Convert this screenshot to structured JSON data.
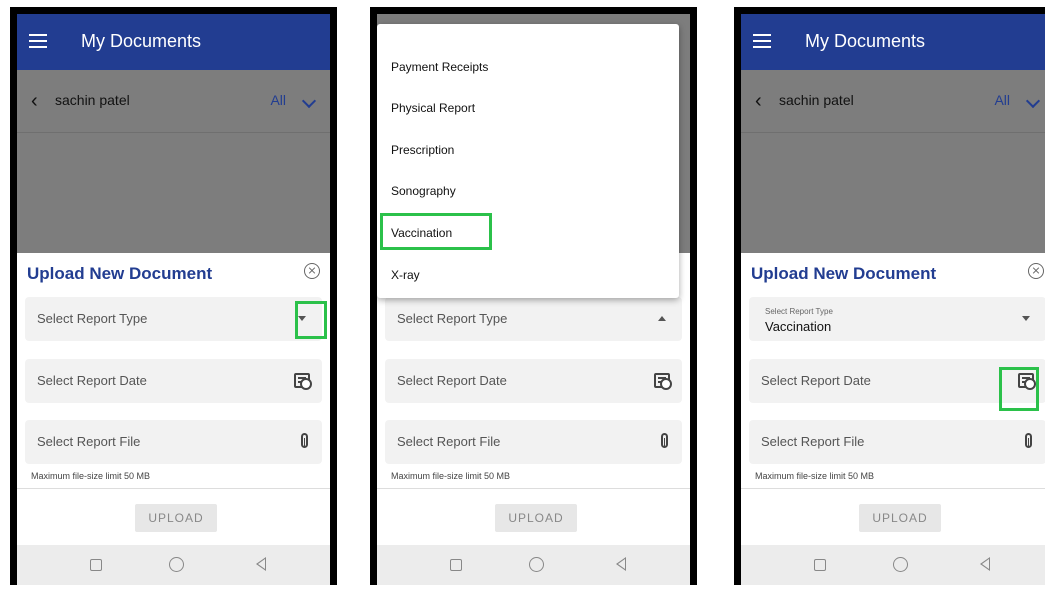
{
  "panels": {
    "left": {
      "appbar": {
        "title": "My Documents"
      },
      "subbar": {
        "user": "sachin patel",
        "filter": "All"
      },
      "sheet": {
        "title": "Upload New Document",
        "report_type_placeholder": "Select Report Type",
        "report_date_placeholder": "Select Report Date",
        "report_file_placeholder": "Select Report File",
        "file_hint": "Maximum file-size limit 50 MB",
        "upload_label": "UPLOAD"
      }
    },
    "middle": {
      "menu_items": [
        "Payment Receipts",
        "Physical Report",
        "Prescription",
        "Sonography",
        "Vaccination",
        "X-ray"
      ],
      "sheet": {
        "report_type_placeholder": "Select Report Type",
        "report_date_placeholder": "Select Report Date",
        "report_file_placeholder": "Select Report File",
        "file_hint": "Maximum file-size limit 50 MB",
        "upload_label": "UPLOAD"
      }
    },
    "right": {
      "appbar": {
        "title": "My Documents"
      },
      "subbar": {
        "user": "sachin patel",
        "filter": "All"
      },
      "sheet": {
        "title": "Upload New Document",
        "report_type_small_label": "Select Report Type",
        "report_type_value": "Vaccination",
        "report_date_placeholder": "Select Report Date",
        "report_file_placeholder": "Select Report File",
        "file_hint": "Maximum file-size limit 50 MB",
        "upload_label": "UPLOAD"
      }
    }
  },
  "colors": {
    "primary": "#223d91",
    "highlight": "#2bc14a",
    "overlay": "#7d7d7d"
  },
  "icons": [
    "menu-icon",
    "back-arrow-icon",
    "chevron-down-icon",
    "close-circle-icon",
    "dropdown-arrow-icon",
    "calendar-clock-icon",
    "paperclip-icon",
    "nav-square-icon",
    "nav-circle-icon",
    "nav-back-icon"
  ]
}
